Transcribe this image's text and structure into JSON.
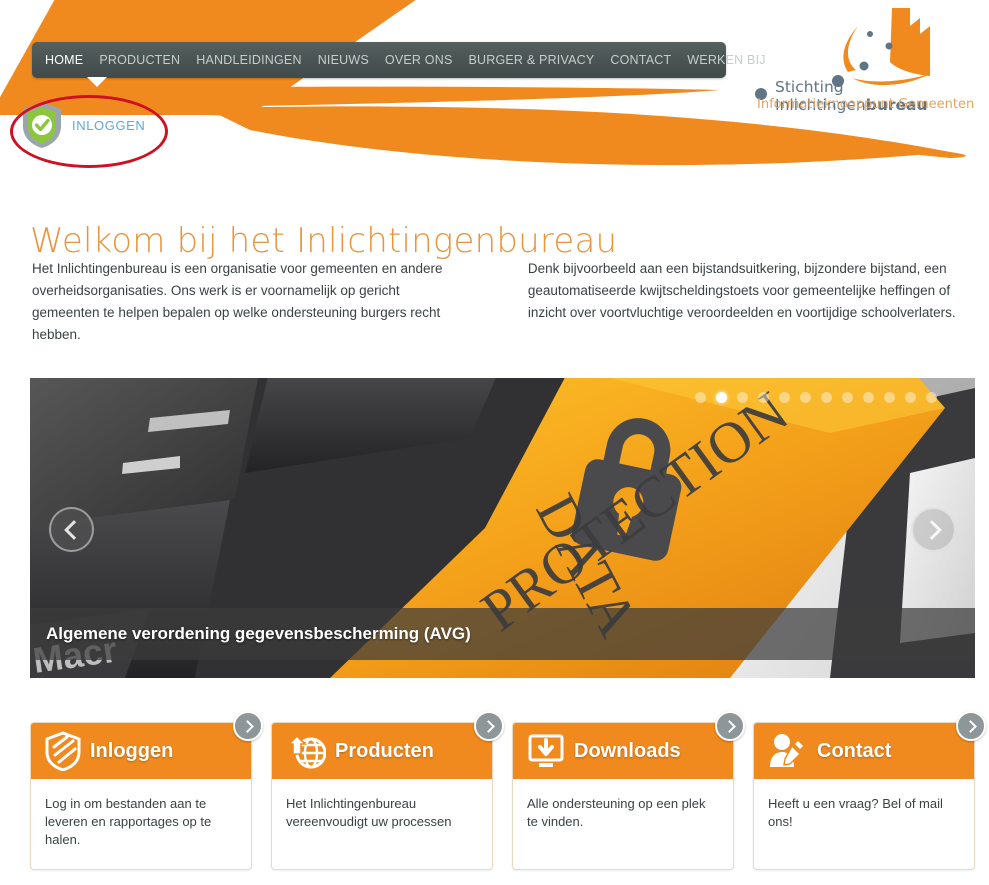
{
  "site": {
    "logo_line1_regular": "Stichting Inlichtingen",
    "logo_line1_bold": "bureau",
    "logo_line2": "Informatieknooppunt Gemeenten"
  },
  "nav": {
    "items": [
      {
        "label": "HOME",
        "active": true
      },
      {
        "label": "PRODUCTEN",
        "active": false
      },
      {
        "label": "HANDLEIDINGEN",
        "active": false
      },
      {
        "label": "NIEUWS",
        "active": false
      },
      {
        "label": "OVER ONS",
        "active": false
      },
      {
        "label": "BURGER & PRIVACY",
        "active": false
      },
      {
        "label": "CONTACT",
        "active": false
      },
      {
        "label": "WERKEN BIJ",
        "active": false
      }
    ]
  },
  "login": {
    "label": "INLOGGEN",
    "icon": "shield-check-icon",
    "annotation_color": "#cc1122"
  },
  "intro": {
    "title": "Welkom bij het Inlichtingenbureau",
    "paragraph_left": "Het Inlichtingenbureau is een organisatie voor gemeenten en andere overheidsorganisaties. Ons werk is er voornamelijk op gericht gemeenten te helpen bepalen op welke ondersteuning burgers recht hebben.",
    "paragraph_right": "Denk bijvoorbeeld aan een bijstandsuitkering, bijzondere bijstand, een geautomatiseerde kwijtscheldingstoets voor gemeentelijke heffingen of inzicht over voortvluchtige veroordeelden en voortijdige schoolverlaters."
  },
  "carousel": {
    "caption": "Algemene verordening gegevensbescherming (AVG)",
    "slide_image_text_top": "DATA",
    "slide_image_text_bottom": "PROTECTION",
    "prev_label": "prev-slide",
    "next_label": "next-slide",
    "dots": [
      {
        "active": false
      },
      {
        "active": true
      },
      {
        "active": false
      },
      {
        "active": false
      },
      {
        "active": false
      },
      {
        "active": false
      },
      {
        "active": false
      },
      {
        "active": false
      },
      {
        "active": false
      },
      {
        "active": false
      },
      {
        "active": false
      },
      {
        "active": false
      }
    ]
  },
  "cards": [
    {
      "title": "Inloggen",
      "text": "Log in om bestanden aan te leveren en rapportages op te halen.",
      "icon": "shield-icon"
    },
    {
      "title": "Producten",
      "text": "Het Inlichtingenbureau vereenvoudigt uw processen",
      "icon": "globe-upload-icon"
    },
    {
      "title": "Downloads",
      "text": "Alle ondersteuning op een plek te vinden.",
      "icon": "download-monitor-icon"
    },
    {
      "title": "Contact",
      "text": "Heeft u een vraag? Bel of mail ons!",
      "icon": "person-pencil-icon"
    }
  ],
  "colors": {
    "orange": "#f18a1e",
    "nav_bg": "#4a5554",
    "link_blue": "#5aabd6",
    "heading_orange": "#e8953f"
  }
}
